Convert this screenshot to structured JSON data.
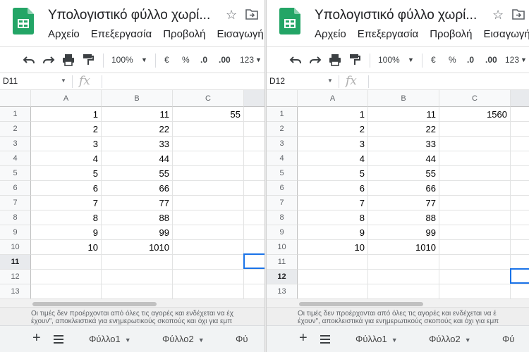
{
  "colors": {
    "accent": "#1a73e8",
    "sheets_green": "#23a566"
  },
  "left": {
    "title": "Υπολογιστικό φύλλο χωρί...",
    "menu": [
      "Αρχείο",
      "Επεξεργασία",
      "Προβολή",
      "Εισαγωγή"
    ],
    "toolbar": {
      "zoom": "100%",
      "currency": "€",
      "percent": "%",
      "dec_less": ".0",
      "dec_more": ".00",
      "format": "123"
    },
    "namebox": "D11",
    "fx": "fx",
    "col_headers": [
      "A",
      "B",
      "C"
    ],
    "rows": [
      {
        "n": "1",
        "a": "1",
        "b": "11",
        "c": "55"
      },
      {
        "n": "2",
        "a": "2",
        "b": "22",
        "c": ""
      },
      {
        "n": "3",
        "a": "3",
        "b": "33",
        "c": ""
      },
      {
        "n": "4",
        "a": "4",
        "b": "44",
        "c": ""
      },
      {
        "n": "5",
        "a": "5",
        "b": "55",
        "c": ""
      },
      {
        "n": "6",
        "a": "6",
        "b": "66",
        "c": ""
      },
      {
        "n": "7",
        "a": "7",
        "b": "77",
        "c": ""
      },
      {
        "n": "8",
        "a": "8",
        "b": "88",
        "c": ""
      },
      {
        "n": "9",
        "a": "9",
        "b": "99",
        "c": ""
      },
      {
        "n": "10",
        "a": "10",
        "b": "1010",
        "c": ""
      },
      {
        "n": "11",
        "a": "",
        "b": "",
        "c": ""
      },
      {
        "n": "12",
        "a": "",
        "b": "",
        "c": ""
      },
      {
        "n": "13",
        "a": "",
        "b": "",
        "c": ""
      }
    ],
    "disclaimer_1": "Οι τιμές δεν προέρχονται από όλες τις αγορές και ενδέχεται να έχ",
    "disclaimer_2": "έχουν\", αποκλειστικά για ενημερωτικούς σκοπούς και όχι για εμπ",
    "tabs": [
      "Φύλλο1",
      "Φύλλο2",
      "Φύ"
    ]
  },
  "right": {
    "title": "Υπολογιστικό φύλλο χωρί...",
    "menu": [
      "Αρχείο",
      "Επεξεργασία",
      "Προβολή",
      "Εισαγωγή"
    ],
    "toolbar": {
      "zoom": "100%",
      "currency": "€",
      "percent": "%",
      "dec_less": ".0",
      "dec_more": ".00",
      "format": "123"
    },
    "namebox": "D12",
    "fx": "fx",
    "col_headers": [
      "A",
      "B",
      "C"
    ],
    "rows": [
      {
        "n": "1",
        "a": "1",
        "b": "11",
        "c": "1560"
      },
      {
        "n": "2",
        "a": "2",
        "b": "22",
        "c": ""
      },
      {
        "n": "3",
        "a": "3",
        "b": "33",
        "c": ""
      },
      {
        "n": "4",
        "a": "4",
        "b": "44",
        "c": ""
      },
      {
        "n": "5",
        "a": "5",
        "b": "55",
        "c": ""
      },
      {
        "n": "6",
        "a": "6",
        "b": "66",
        "c": ""
      },
      {
        "n": "7",
        "a": "7",
        "b": "77",
        "c": ""
      },
      {
        "n": "8",
        "a": "8",
        "b": "88",
        "c": ""
      },
      {
        "n": "9",
        "a": "9",
        "b": "99",
        "c": ""
      },
      {
        "n": "10",
        "a": "10",
        "b": "1010",
        "c": ""
      },
      {
        "n": "11",
        "a": "",
        "b": "",
        "c": ""
      },
      {
        "n": "12",
        "a": "",
        "b": "",
        "c": ""
      },
      {
        "n": "13",
        "a": "",
        "b": "",
        "c": ""
      }
    ],
    "disclaimer_1": "Οι τιμές δεν προέρχονται από όλες τις αγορές και ενδέχεται να έ",
    "disclaimer_2": "έχουν\", αποκλειστικά για ενημερωτικούς σκοπούς και όχι για εμπ",
    "tabs": [
      "Φύλλο1",
      "Φύλλο2",
      "Φύ"
    ]
  }
}
